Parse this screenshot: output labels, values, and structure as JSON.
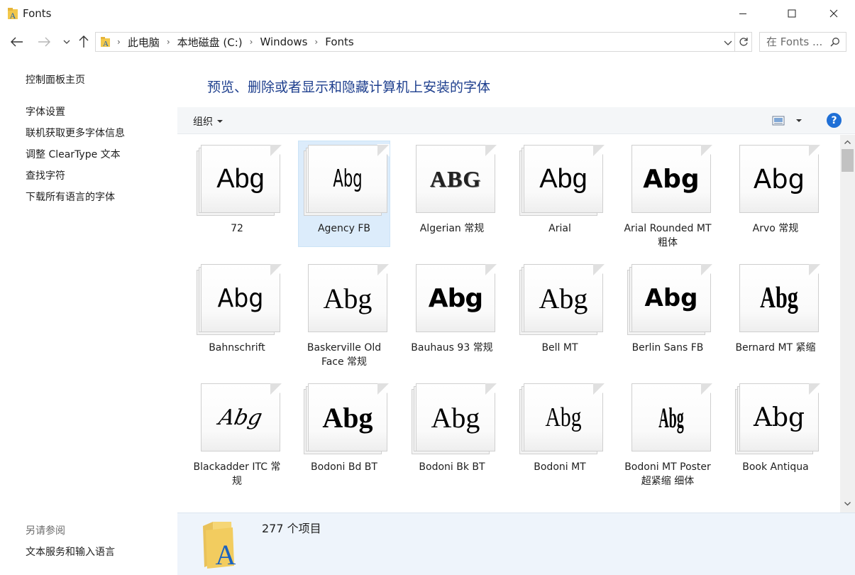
{
  "window": {
    "title": "Fonts"
  },
  "address": {
    "crumbs": [
      "此电脑",
      "本地磁盘 (C:)",
      "Windows",
      "Fonts"
    ]
  },
  "search": {
    "placeholder": "在 Fonts ..."
  },
  "left_pane": {
    "links": [
      "控制面板主页",
      "字体设置",
      "联机获取更多字体信息",
      "调整 ClearType 文本",
      "查找字符",
      "下载所有语言的字体"
    ],
    "see_also_title": "另请参阅",
    "see_also": [
      "文本服务和输入语言"
    ]
  },
  "main": {
    "heading": "预览、删除或者显示和隐藏计算机上安装的字体",
    "organize_label": "组织",
    "help_label": "?"
  },
  "fonts": [
    {
      "name": "72",
      "sample": "Abg"
    },
    {
      "name": "Agency FB",
      "sample": "Abg"
    },
    {
      "name": "Algerian 常规",
      "sample": "ABG"
    },
    {
      "name": "Arial",
      "sample": "Abg"
    },
    {
      "name": "Arial Rounded MT 粗体",
      "sample": "Abg"
    },
    {
      "name": "Arvo 常规",
      "sample": "Abg"
    },
    {
      "name": "Bahnschrift",
      "sample": "Abg"
    },
    {
      "name": "Baskerville Old Face 常规",
      "sample": "Abg"
    },
    {
      "name": "Bauhaus 93 常规",
      "sample": "Abg"
    },
    {
      "name": "Bell MT",
      "sample": "Abg"
    },
    {
      "name": "Berlin Sans FB",
      "sample": "Abg"
    },
    {
      "name": "Bernard MT 紧缩",
      "sample": "Abg"
    },
    {
      "name": "Blackadder ITC 常规",
      "sample": "Abg"
    },
    {
      "name": "Bodoni Bd BT",
      "sample": "Abg"
    },
    {
      "name": "Bodoni Bk BT",
      "sample": "Abg"
    },
    {
      "name": "Bodoni MT",
      "sample": "Abg"
    },
    {
      "name": "Bodoni MT Poster 超紧缩 细体",
      "sample": "Abg"
    },
    {
      "name": "Book Antiqua",
      "sample": "Abg"
    }
  ],
  "details": {
    "count_text": "277 个项目"
  },
  "colors": {
    "heading": "#1e3f8e",
    "selection": "#dcecfb",
    "details_bg": "#eef4fb",
    "help": "#1f6fd6"
  }
}
